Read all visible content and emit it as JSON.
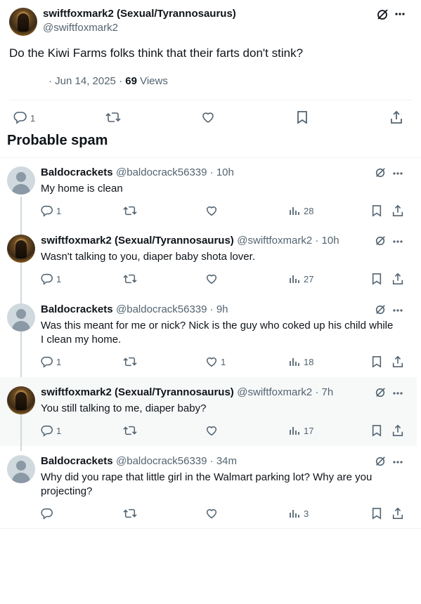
{
  "main_tweet": {
    "author_name": "swiftfoxmark2 (Sexual/Tyrannosaurus)",
    "handle": "@swiftfoxmark2",
    "text": "Do the Kiwi Farms folks think that their farts don't stink?",
    "date": "· Jun 14, 2025 ·",
    "views_count": "69",
    "views_label": "Views",
    "replies": "1"
  },
  "section_title": "Probable spam",
  "replies": [
    {
      "name": "Baldocrackets",
      "handle": "@baldocrack56339 · 10h",
      "text": "My home is clean",
      "reply": "1",
      "like": "",
      "views": "28"
    },
    {
      "name": "swiftfoxmark2 (Sexual/Tyrannosaurus)",
      "handle": "@swiftfoxmark2 · 10h",
      "text": "Wasn't talking to you, diaper baby shota lover.",
      "reply": "1",
      "like": "",
      "views": "27"
    },
    {
      "name": "Baldocrackets",
      "handle": "@baldocrack56339 · 9h",
      "text1": "Was this meant for me or nick? Nick is the guy who coked up his child while",
      "text2": "I clean my home.",
      "reply": "1",
      "like": "1",
      "views": "18"
    },
    {
      "name": "swiftfoxmark2 (Sexual/Tyrannosaurus)",
      "handle": "@swiftfoxmark2 · 7h",
      "text": "You still talking to me, diaper baby?",
      "reply": "1",
      "like": "",
      "views": "17"
    },
    {
      "name": "Baldocrackets",
      "handle": "@baldocrack56339 · 34m",
      "text1": "Why did you rape that little girl in the Walmart parking lot? Why are you",
      "text2": "projecting?",
      "reply": "",
      "like": "",
      "views": "3"
    }
  ]
}
